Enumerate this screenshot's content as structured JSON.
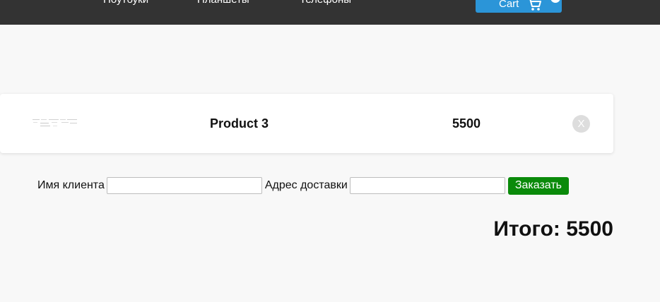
{
  "nav": {
    "items": [
      {
        "label": "Ноутбуки"
      },
      {
        "label": "Планшеты"
      },
      {
        "label": "Телефоны"
      }
    ],
    "cart_label": "Cart",
    "cart_icon": "shopping-cart-icon"
  },
  "cart": {
    "items": [
      {
        "name": "Product 3",
        "price": "5500",
        "remove_label": "X",
        "thumbnail_icon": "product-thumbnail"
      }
    ]
  },
  "order_form": {
    "client_name_label": "Имя клиента",
    "client_name_value": "",
    "address_label": "Адрес доставки",
    "address_value": "",
    "submit_label": "Заказать"
  },
  "total": "Итого: 5500",
  "colors": {
    "navbar": "#333333",
    "cart_button": "#2b95d8",
    "order_button": "#0a8a0a",
    "page_background": "#f8f8f8"
  }
}
